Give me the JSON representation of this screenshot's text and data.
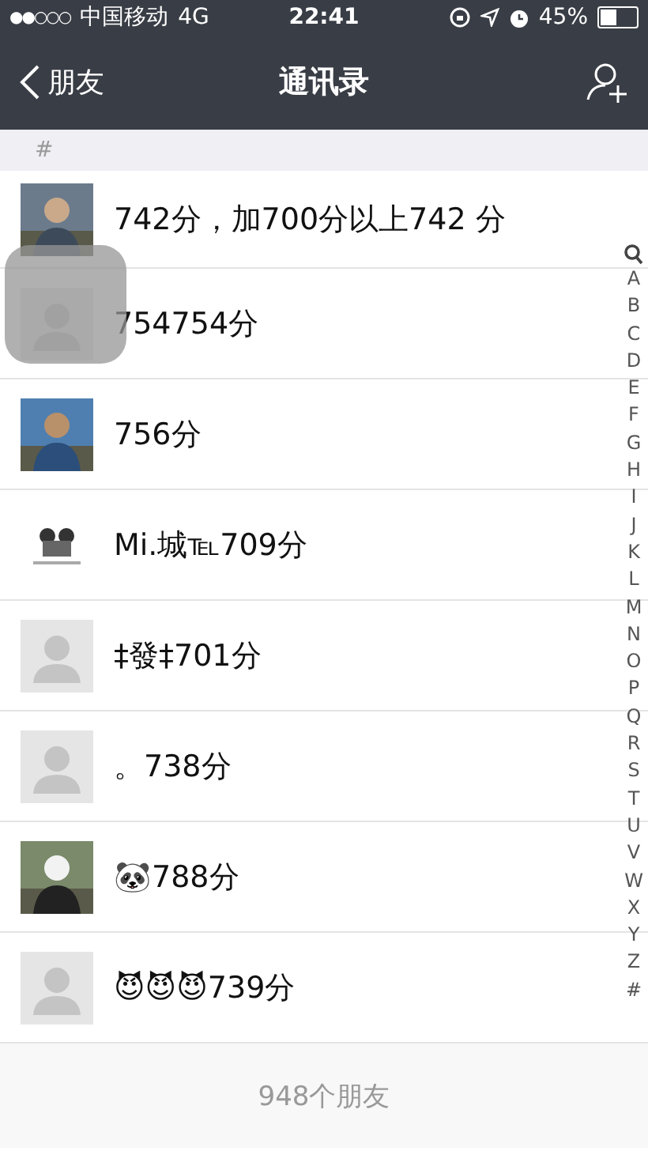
{
  "status_bar": {
    "signal": "●●○○○",
    "carrier": "中国移动",
    "network": "4G",
    "time": "22:41",
    "battery": "45%"
  },
  "nav": {
    "back": "朋友",
    "title": "通讯录"
  },
  "section": "#",
  "contacts": [
    {
      "name": "742分，加700分以上742 分"
    },
    {
      "name": "754754分",
      "kind": "default"
    },
    {
      "name": "756分"
    },
    {
      "name": "Mi.城℡709分",
      "kind": "logo"
    },
    {
      "name": "‡發‡701分",
      "kind": "default"
    },
    {
      "name": "。738分",
      "kind": "default"
    },
    {
      "name": "🐼788分"
    },
    {
      "name": "😈😈😈739分",
      "kind": "default"
    }
  ],
  "index": [
    "A",
    "B",
    "C",
    "D",
    "E",
    "F",
    "G",
    "H",
    "I",
    "J",
    "K",
    "L",
    "M",
    "N",
    "O",
    "P",
    "Q",
    "R",
    "S",
    "T",
    "U",
    "V",
    "W",
    "X",
    "Y",
    "Z",
    "#"
  ],
  "footer": "948个朋友"
}
